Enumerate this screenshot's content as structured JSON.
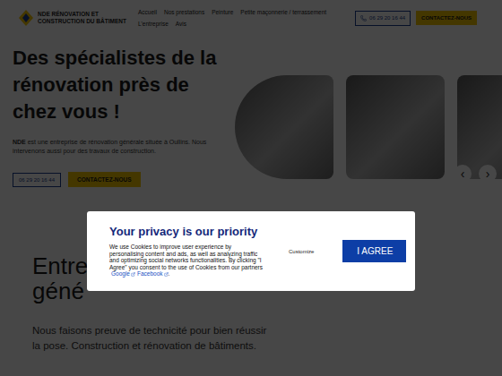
{
  "header": {
    "logo_lines": [
      "NDE RÉNOVATION ET",
      "CONSTRUCTION DU BÂTIMENT"
    ],
    "nav_rows": [
      [
        "Accueil",
        "Nos prestations",
        "Peinture",
        "Petite maçonnerie / terrassement"
      ],
      [
        "L'entreprise",
        "Avis"
      ]
    ],
    "phone": "06 29 20 16 44",
    "cta": "CONTACTEZ-NOUS"
  },
  "hero": {
    "title": "Des spécialistes de la rénovation près de chez vous !",
    "text_bold": "NDE",
    "text": " est une entreprise de rénovation générale située à Oullins. Nous intervenons aussi pour des travaux de construction.",
    "phone": "06 29 20 16 44",
    "cta": "CONTACTEZ-NOUS"
  },
  "carousel": {
    "prev": "‹",
    "next": "›"
  },
  "about": {
    "title_lines": [
      "Entre",
      "géné"
    ],
    "text": "Nous faisons preuve de technicité pour bien réussir la pose. Construction et rénovation de bâtiments."
  },
  "cookie_dialog": {
    "title": "Your privacy is our priority",
    "text": "We use Cookies to improve user experience by personalising content and ads, as well as analyzing traffic and optimizing social networks functionalities. By clicking \"I Agree\" you consent to the use of Cookies from our partners",
    "links": [
      "Google",
      "Facebook"
    ],
    "end": ".",
    "customize": "Customize",
    "agree": "I AGREE"
  }
}
